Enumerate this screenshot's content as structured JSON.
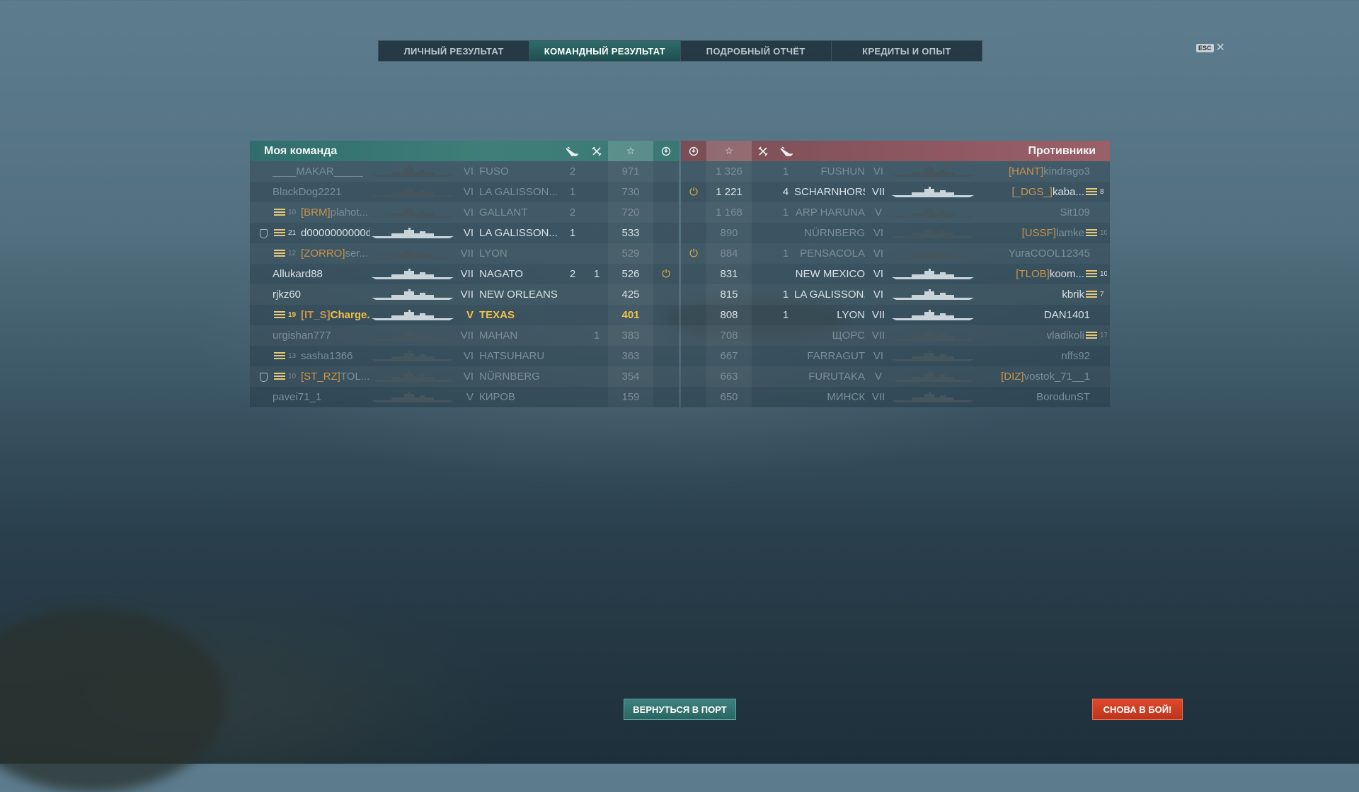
{
  "tabs": [
    {
      "label": "ЛИЧНЫЙ РЕЗУЛЬТАТ",
      "active": false
    },
    {
      "label": "КОМАНДНЫЙ РЕЗУЛЬТАТ",
      "active": true
    },
    {
      "label": "ПОДРОБНЫЙ ОТЧЁТ",
      "active": false
    },
    {
      "label": "КРЕДИТЫ И ОПЫТ",
      "active": false
    }
  ],
  "esc": {
    "badge": "ESC",
    "close": "✕"
  },
  "my_team": {
    "title": "Моя команда",
    "columns": {
      "ships_icon": "ship-sunk-icon",
      "planes_icon": "plane-icon",
      "exp": "☆",
      "base_icon": "base-capture-icon"
    },
    "players": [
      {
        "name": "____MAKAR_____",
        "clan": "",
        "rank": "",
        "tier": "VI",
        "ship": "FUSO",
        "kills": "2",
        "planes": "",
        "exp": "971",
        "base": "",
        "status": "dead"
      },
      {
        "name": "BlackDog2221",
        "clan": "",
        "rank": "",
        "tier": "VI",
        "ship": "LA GALISSON...",
        "kills": "1",
        "planes": "",
        "exp": "730",
        "base": "",
        "status": "dead"
      },
      {
        "name": "plahot...",
        "clan": "[BRM]",
        "rank": "10",
        "tier": "VI",
        "ship": "GALLANT",
        "kills": "2",
        "planes": "",
        "exp": "720",
        "base": "",
        "status": "dead"
      },
      {
        "name": "d0000000000d",
        "clan": "",
        "rank": "21",
        "tier": "VI",
        "ship": "LA GALISSON...",
        "kills": "1",
        "planes": "",
        "exp": "533",
        "base": "",
        "status": "alive",
        "shield": true
      },
      {
        "name": "ser...",
        "clan": "[ZORRO]",
        "rank": "12",
        "tier": "VII",
        "ship": "LYON",
        "kills": "",
        "planes": "",
        "exp": "529",
        "base": "",
        "status": "dead"
      },
      {
        "name": "Allukard88",
        "clan": "",
        "rank": "",
        "tier": "VII",
        "ship": "NAGATO",
        "kills": "2",
        "planes": "1",
        "exp": "526",
        "base": "⏻",
        "status": "alive"
      },
      {
        "name": "rjkz60",
        "clan": "",
        "rank": "",
        "tier": "VII",
        "ship": "NEW ORLEANS",
        "kills": "",
        "planes": "",
        "exp": "425",
        "base": "",
        "status": "alive"
      },
      {
        "name": "Charge...",
        "clan": "[IT_S]",
        "rank": "19",
        "tier": "V",
        "ship": "TEXAS",
        "kills": "",
        "planes": "",
        "exp": "401",
        "base": "",
        "status": "me"
      },
      {
        "name": "urgishan777",
        "clan": "",
        "rank": "",
        "tier": "VII",
        "ship": "MAHAN",
        "kills": "",
        "planes": "1",
        "exp": "383",
        "base": "",
        "status": "dead"
      },
      {
        "name": "sasha1366",
        "clan": "",
        "rank": "13",
        "tier": "VI",
        "ship": "HATSUHARU",
        "kills": "",
        "planes": "",
        "exp": "363",
        "base": "",
        "status": "dead"
      },
      {
        "name": "TOL...",
        "clan": "[ST_RZ]",
        "rank": "10",
        "tier": "VI",
        "ship": "NÜRNBERG",
        "kills": "",
        "planes": "",
        "exp": "354",
        "base": "",
        "status": "dead",
        "shield": true
      },
      {
        "name": "pavei71_1",
        "clan": "",
        "rank": "",
        "tier": "V",
        "ship": "КИРОВ",
        "kills": "",
        "planes": "",
        "exp": "159",
        "base": "",
        "status": "dead"
      }
    ]
  },
  "enemy_team": {
    "title": "Противники",
    "players": [
      {
        "name": "kindrago3",
        "clan": "[HANT]",
        "rank": "",
        "tier": "VI",
        "ship": "FUSHUN",
        "kills": "1",
        "exp": "1 326",
        "base": "",
        "status": "dead"
      },
      {
        "name": "kaba...",
        "clan": "[_DGS_]",
        "rank": "8",
        "tier": "VII",
        "ship": "SCHARNHORST",
        "kills": "4",
        "exp": "1 221",
        "base": "⏻",
        "status": "alive"
      },
      {
        "name": "Sit109",
        "clan": "",
        "rank": "",
        "tier": "V",
        "ship": "ARP HARUNA",
        "kills": "1",
        "exp": "1 168",
        "base": "",
        "status": "dead"
      },
      {
        "name": "lamke",
        "clan": "[USSF]",
        "rank": "10",
        "tier": "VI",
        "ship": "NÜRNBERG",
        "kills": "",
        "exp": "890",
        "base": "",
        "status": "dead"
      },
      {
        "name": "YuraCOOL12345",
        "clan": "",
        "rank": "",
        "tier": "VI",
        "ship": "PENSACOLA",
        "kills": "1",
        "exp": "884",
        "base": "⏻",
        "status": "dead"
      },
      {
        "name": "koom...",
        "clan": "[TLOB]",
        "rank": "10",
        "tier": "VI",
        "ship": "NEW MEXICO",
        "kills": "",
        "exp": "831",
        "base": "",
        "status": "alive"
      },
      {
        "name": "kbrik",
        "clan": "",
        "rank": "7",
        "tier": "VI",
        "ship": "LA GALISSON...",
        "kills": "1",
        "exp": "815",
        "base": "",
        "status": "alive"
      },
      {
        "name": "DAN1401",
        "clan": "",
        "rank": "",
        "tier": "VII",
        "ship": "LYON",
        "kills": "1",
        "exp": "808",
        "base": "",
        "status": "alive"
      },
      {
        "name": "vladikoli",
        "clan": "",
        "rank": "17",
        "tier": "VII",
        "ship": "ЩОРС",
        "kills": "",
        "exp": "708",
        "base": "",
        "status": "dead"
      },
      {
        "name": "nffs92",
        "clan": "",
        "rank": "",
        "tier": "VI",
        "ship": "FARRAGUT",
        "kills": "",
        "exp": "667",
        "base": "",
        "status": "dead"
      },
      {
        "name": "vostok_71__1",
        "clan": "[DIZ]",
        "rank": "",
        "tier": "V",
        "ship": "FURUTAKA",
        "kills": "",
        "exp": "663",
        "base": "",
        "status": "dead"
      },
      {
        "name": "BorodunST",
        "clan": "",
        "rank": "",
        "tier": "VII",
        "ship": "МИНСК",
        "kills": "",
        "exp": "650",
        "base": "",
        "status": "dead"
      }
    ]
  },
  "buttons": {
    "port": "ВЕРНУТЬСЯ В ПОРТ",
    "battle": "СНОВА В БОЙ!"
  },
  "colors": {
    "ally_header": "#3f7f7a",
    "enemy_header": "#8f5860",
    "player_highlight": "#f2c24a",
    "clan_orange": "#c9944a",
    "battle_button": "#d8432a",
    "port_button": "#347370"
  }
}
